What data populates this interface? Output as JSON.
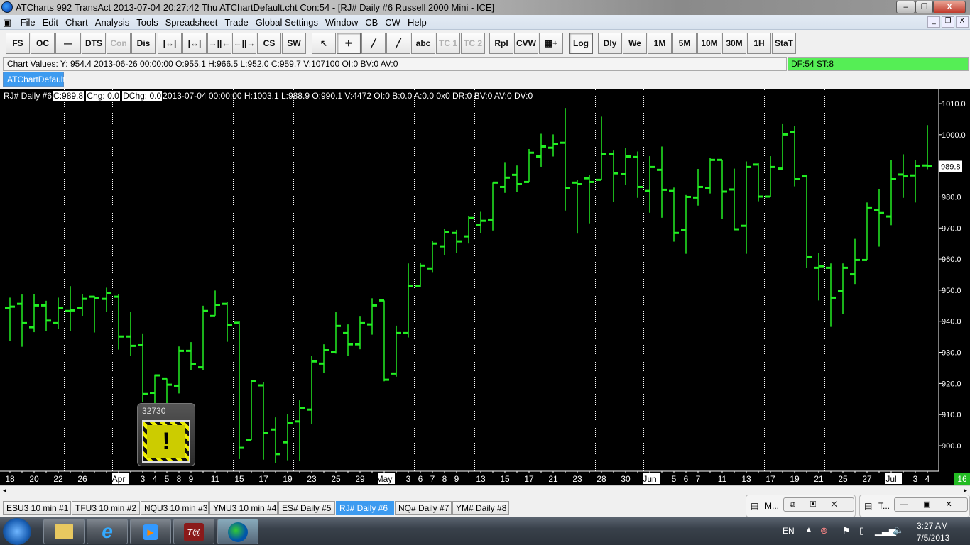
{
  "window": {
    "title": "ATCharts 992 TransAct 2013-07-04  20:27:42 Thu  ATChartDefault.cht Con:54 - [RJ#  Daily  #6  Russell 2000 Mini - ICE]",
    "minimize": "–",
    "restore": "❐",
    "close": "X"
  },
  "menu": [
    "File",
    "Edit",
    "Chart",
    "Analysis",
    "Tools",
    "Spreadsheet",
    "Trade",
    "Global Settings",
    "Window",
    "CB",
    "CW",
    "Help"
  ],
  "mdi_controls": {
    "minimize": "_",
    "restore": "❐",
    "close": "X"
  },
  "toolbar": {
    "group1": [
      "FS",
      "OC",
      "—",
      "DTS",
      "Con",
      "Dis"
    ],
    "group2": [
      "|↔|",
      "|↔|",
      "→||←",
      "←||→",
      "CS",
      "SW"
    ],
    "group3": [
      "↖",
      "✛",
      "╱",
      "╱",
      "abc",
      "TC 1",
      "TC 2"
    ],
    "group4": [
      "Rpl",
      "CVW",
      "▦+",
      "Log"
    ],
    "group5": [
      "Dly",
      "We",
      "1M",
      "5M",
      "10M",
      "30M",
      "1H",
      "StaT"
    ]
  },
  "values_bar": "Chart Values: Y: 954.4  2013-06-26  00:00:00  O:955.1  H:966.5  L:952.0  C:959.7  V:107100  OI:0  BV:0  AV:0",
  "status": "DF:54  ST:8",
  "chart_tab": "ATChartDefault",
  "info": {
    "symbol": "RJ#  Daily  #6",
    "close": "C:989.8",
    "chg": "Chg: 0.0",
    "dchg": "DChg: 0.0",
    "rest": "2013-07-04 00:00:00 H:1003.1 L:988.9 O:990.1 V:4472 OI:0 B:0.0 A:0.0 0x0 DR:0 BV:0 AV:0 DV:0"
  },
  "popup": {
    "number": "32730",
    "icon": "warning-icon"
  },
  "corner_label": "16",
  "chart_data": {
    "type": "ohlc",
    "ylim": [
      895,
      1012
    ],
    "yticks": [
      900,
      910,
      920,
      930,
      940,
      950,
      960,
      970,
      980,
      990,
      1000,
      1010
    ],
    "last_price": "989.8",
    "bar_color": "#22ee22",
    "bars": [
      [
        "2013-03-18",
        944.3,
        947.6,
        933.6,
        944.7,
        "18",
        0,
        0
      ],
      [
        "2013-03-19",
        945.6,
        948.6,
        931.8,
        939.4,
        "",
        0,
        0
      ],
      [
        "2013-03-20",
        938.1,
        948.8,
        936.5,
        945.1,
        "20",
        0,
        0
      ],
      [
        "2013-03-21",
        945.1,
        946.6,
        936.8,
        940.2,
        "",
        0,
        0
      ],
      [
        "2013-03-22",
        939.4,
        947.6,
        937.5,
        944.2,
        "22",
        0,
        0
      ],
      [
        "2013-03-25",
        943.3,
        951.3,
        936.8,
        943.5,
        "",
        1,
        0
      ],
      [
        "2013-03-26",
        944.3,
        948.8,
        941.6,
        947.2,
        "26",
        0,
        0
      ],
      [
        "2013-03-27",
        947.9,
        948.2,
        936.4,
        947.4,
        "",
        0,
        0
      ],
      [
        "2013-03-28",
        947.2,
        950.8,
        943.0,
        949.0,
        "",
        0,
        0
      ],
      [
        "2013-04-01",
        947.9,
        948.8,
        930.9,
        935.1,
        "Apr",
        1,
        1
      ],
      [
        "2013-04-02",
        935.1,
        943.1,
        928.9,
        932.1,
        "",
        0,
        0
      ],
      [
        "2013-04-03",
        932.3,
        936.1,
        914.0,
        916.6,
        "3",
        0,
        0
      ],
      [
        "2013-04-04",
        917.0,
        922.9,
        913.0,
        922.6,
        "4",
        0,
        0
      ],
      [
        "2013-04-05",
        921.6,
        921.6,
        913.5,
        919.6,
        "5",
        0,
        0
      ],
      [
        "2013-04-08",
        919.3,
        931.9,
        916.8,
        930.5,
        "8",
        1,
        0
      ],
      [
        "2013-04-09",
        930.5,
        933.3,
        924.3,
        926.2,
        "9",
        0,
        0
      ],
      [
        "2013-04-10",
        925.2,
        945.0,
        924.3,
        943.3,
        "",
        0,
        0
      ],
      [
        "2013-04-11",
        941.7,
        949.9,
        941.8,
        945.3,
        "11",
        0,
        0
      ],
      [
        "2013-04-12",
        945.6,
        946.3,
        933.4,
        938.9,
        "",
        0,
        0
      ],
      [
        "2013-04-15",
        939.5,
        939.9,
        895.7,
        899.3,
        "15",
        1,
        0
      ],
      [
        "2013-04-16",
        901.8,
        921.2,
        901.8,
        920.8,
        "",
        0,
        0
      ],
      [
        "2013-04-17",
        919.4,
        920.5,
        895.5,
        904.0,
        "17",
        0,
        0
      ],
      [
        "2013-04-18",
        905.2,
        909.1,
        894.5,
        897.3,
        "",
        0,
        0
      ],
      [
        "2013-04-19",
        901.1,
        910.2,
        895.3,
        907.3,
        "19",
        0,
        0
      ],
      [
        "2013-04-22",
        907.8,
        914.6,
        895.1,
        912.1,
        "",
        1,
        0
      ],
      [
        "2013-04-23",
        911.6,
        928.8,
        907.0,
        927.1,
        "23",
        0,
        0
      ],
      [
        "2013-04-24",
        926.4,
        932.6,
        923.3,
        930.7,
        "",
        0,
        0
      ],
      [
        "2013-04-25",
        930.2,
        942.9,
        929.6,
        938.5,
        "25",
        0,
        0
      ],
      [
        "2013-04-26",
        936.2,
        939.0,
        928.8,
        932.6,
        "",
        0,
        0
      ],
      [
        "2013-04-29",
        932.6,
        941.5,
        931.0,
        939.4,
        "29",
        1,
        0
      ],
      [
        "2013-04-30",
        939.0,
        947.4,
        935.7,
        945.1,
        "",
        0,
        0
      ],
      [
        "2013-05-01",
        946.7,
        946.7,
        920.7,
        921.2,
        "May",
        0,
        1
      ],
      [
        "2013-05-02",
        923.2,
        938.6,
        922.2,
        936.2,
        "",
        0,
        0
      ],
      [
        "2013-05-03",
        936.2,
        958.6,
        934.8,
        951.3,
        "3",
        0,
        0
      ],
      [
        "2013-05-06",
        951.3,
        958.9,
        951.1,
        957.9,
        "6",
        1,
        0
      ],
      [
        "2013-05-07",
        957.0,
        965.9,
        955.6,
        965.0,
        "7",
        0,
        0
      ],
      [
        "2013-05-08",
        964.1,
        969.7,
        961.3,
        968.8,
        "8",
        0,
        0
      ],
      [
        "2013-05-09",
        968.4,
        969.4,
        961.9,
        965.7,
        "9",
        0,
        0
      ],
      [
        "2013-05-10",
        967.3,
        973.9,
        965.0,
        973.2,
        "",
        0,
        0
      ],
      [
        "2013-05-13",
        970.9,
        975.2,
        968.3,
        972.3,
        "13",
        1,
        0
      ],
      [
        "2013-05-14",
        972.7,
        984.6,
        969.2,
        984.6,
        "",
        0,
        0
      ],
      [
        "2013-05-15",
        983.2,
        991.2,
        981.3,
        986.2,
        "15",
        0,
        0
      ],
      [
        "2013-05-16",
        987.1,
        990.1,
        981.7,
        984.1,
        "",
        0,
        0
      ],
      [
        "2013-05-17",
        984.8,
        995.4,
        984.8,
        994.2,
        "17",
        0,
        0
      ],
      [
        "2013-05-20",
        993.0,
        1000.3,
        989.7,
        996.2,
        "",
        1,
        0
      ],
      [
        "2013-05-21",
        995.8,
        1000.1,
        993.0,
        996.9,
        "21",
        0,
        0
      ],
      [
        "2013-05-22",
        997.4,
        1008.6,
        975.6,
        982.8,
        "",
        0,
        0
      ],
      [
        "2013-05-23",
        984.6,
        985.5,
        968.2,
        984.1,
        "23",
        0,
        0
      ],
      [
        "2013-05-24",
        986.0,
        987.1,
        971.5,
        984.8,
        "",
        0,
        0
      ],
      [
        "2013-05-28",
        985.5,
        1005.8,
        985.5,
        993.7,
        "28",
        1,
        0
      ],
      [
        "2013-05-29",
        993.7,
        994.9,
        978.4,
        987.6,
        "",
        0,
        0
      ],
      [
        "2013-05-30",
        987.3,
        995.8,
        983.8,
        993.0,
        "30",
        0,
        0
      ],
      [
        "2013-05-31",
        992.8,
        994.6,
        979.7,
        983.2,
        "",
        0,
        0
      ],
      [
        "2013-06-03",
        981.9,
        993.1,
        974.9,
        989.6,
        "Jun",
        1,
        1
      ],
      [
        "2013-06-04",
        988.7,
        996.2,
        973.3,
        982.3,
        "",
        0,
        0
      ],
      [
        "2013-06-05",
        981.9,
        983.0,
        965.6,
        968.4,
        "5",
        0,
        0
      ],
      [
        "2013-06-06",
        969.5,
        980.6,
        961.7,
        980.0,
        "6",
        0,
        0
      ],
      [
        "2013-06-07",
        979.8,
        989.0,
        977.2,
        983.2,
        "7",
        0,
        0
      ],
      [
        "2013-06-10",
        982.8,
        992.6,
        981.1,
        991.9,
        "",
        1,
        0
      ],
      [
        "2013-06-11",
        991.9,
        991.9,
        972.9,
        981.7,
        "11",
        0,
        0
      ],
      [
        "2013-06-12",
        982.4,
        989.1,
        969.6,
        969.6,
        "",
        0,
        0
      ],
      [
        "2013-06-13",
        970.7,
        991.4,
        961.7,
        989.6,
        "13",
        0,
        0
      ],
      [
        "2013-06-14",
        990.4,
        990.8,
        978.6,
        980.1,
        "",
        0,
        0
      ],
      [
        "2013-06-17",
        980.1,
        993.1,
        980.1,
        989.6,
        "17",
        1,
        0
      ],
      [
        "2013-06-18",
        989.1,
        1003.4,
        989.1,
        1000.1,
        "",
        0,
        0
      ],
      [
        "2013-06-19",
        1000.8,
        1002.7,
        983.4,
        985.7,
        "19",
        0,
        0
      ],
      [
        "2013-06-20",
        986.6,
        986.6,
        957.2,
        960.6,
        "",
        0,
        0
      ],
      [
        "2013-06-21",
        957.2,
        962.0,
        946.7,
        957.7,
        "21",
        0,
        0
      ],
      [
        "2013-06-24",
        957.2,
        958.6,
        938.2,
        947.6,
        "",
        1,
        0
      ],
      [
        "2013-06-25",
        949.7,
        958.6,
        942.3,
        957.2,
        "25",
        0,
        0
      ],
      [
        "2013-06-26",
        955.1,
        966.5,
        952.0,
        959.7,
        "",
        0,
        0
      ],
      [
        "2013-06-27",
        959.7,
        978.2,
        959.7,
        976.6,
        "27",
        0,
        0
      ],
      [
        "2013-06-28",
        975.8,
        982.4,
        964.0,
        974.8,
        "",
        0,
        0
      ],
      [
        "2013-07-01",
        973.7,
        991.9,
        970.9,
        985.7,
        "Jul",
        1,
        1
      ],
      [
        "2013-07-02",
        987.2,
        993.7,
        979.7,
        986.6,
        "",
        0,
        0
      ],
      [
        "2013-07-03",
        986.9,
        991.9,
        978.2,
        989.8,
        "3",
        0,
        0
      ],
      [
        "2013-07-04",
        990.1,
        1003.1,
        988.9,
        989.8,
        "4",
        0,
        0
      ]
    ]
  },
  "bottom_tabs": [
    "ESU3  10 min   #1",
    "TFU3  10 min   #2",
    "NQU3  10 min   #3",
    "YMU3  10 min   #4",
    "ES#  Daily  #5",
    "RJ#  Daily  #6",
    "NQ#  Daily  #7",
    "YM#  Daily  #8"
  ],
  "active_tab": 5,
  "mini_windows": [
    {
      "title": "M..."
    },
    {
      "title": "T..."
    }
  ],
  "taskbar": {
    "items": [
      "start-button",
      "explorer",
      "internet-explorer",
      "media-player",
      "transact",
      "atcharts"
    ],
    "lang": "EN",
    "time": "3:27 AM",
    "date": "7/5/2013"
  }
}
